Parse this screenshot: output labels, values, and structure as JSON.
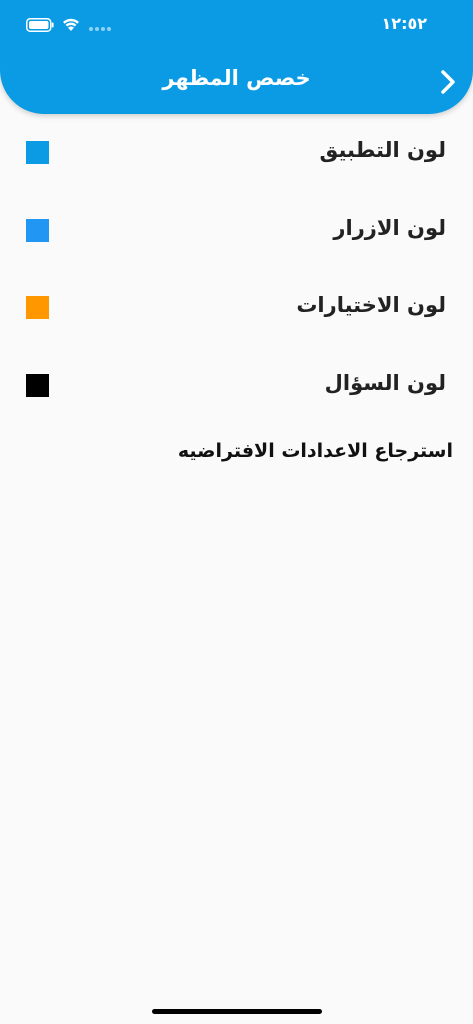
{
  "status_bar": {
    "time": "١٢:٥٢"
  },
  "header": {
    "title": "خصص المظهر",
    "back_icon": "chevron-right-icon"
  },
  "settings": {
    "items": [
      {
        "label": "لون التطبيق",
        "color": "#0a9be4"
      },
      {
        "label": "لون الازرار",
        "color": "#2196f3"
      },
      {
        "label": "لون الاختيارات",
        "color": "#ff9800"
      },
      {
        "label": "لون السؤال",
        "color": "#000000"
      }
    ],
    "reset_label": "استرجاع الاعدادات الافتراضيه"
  }
}
